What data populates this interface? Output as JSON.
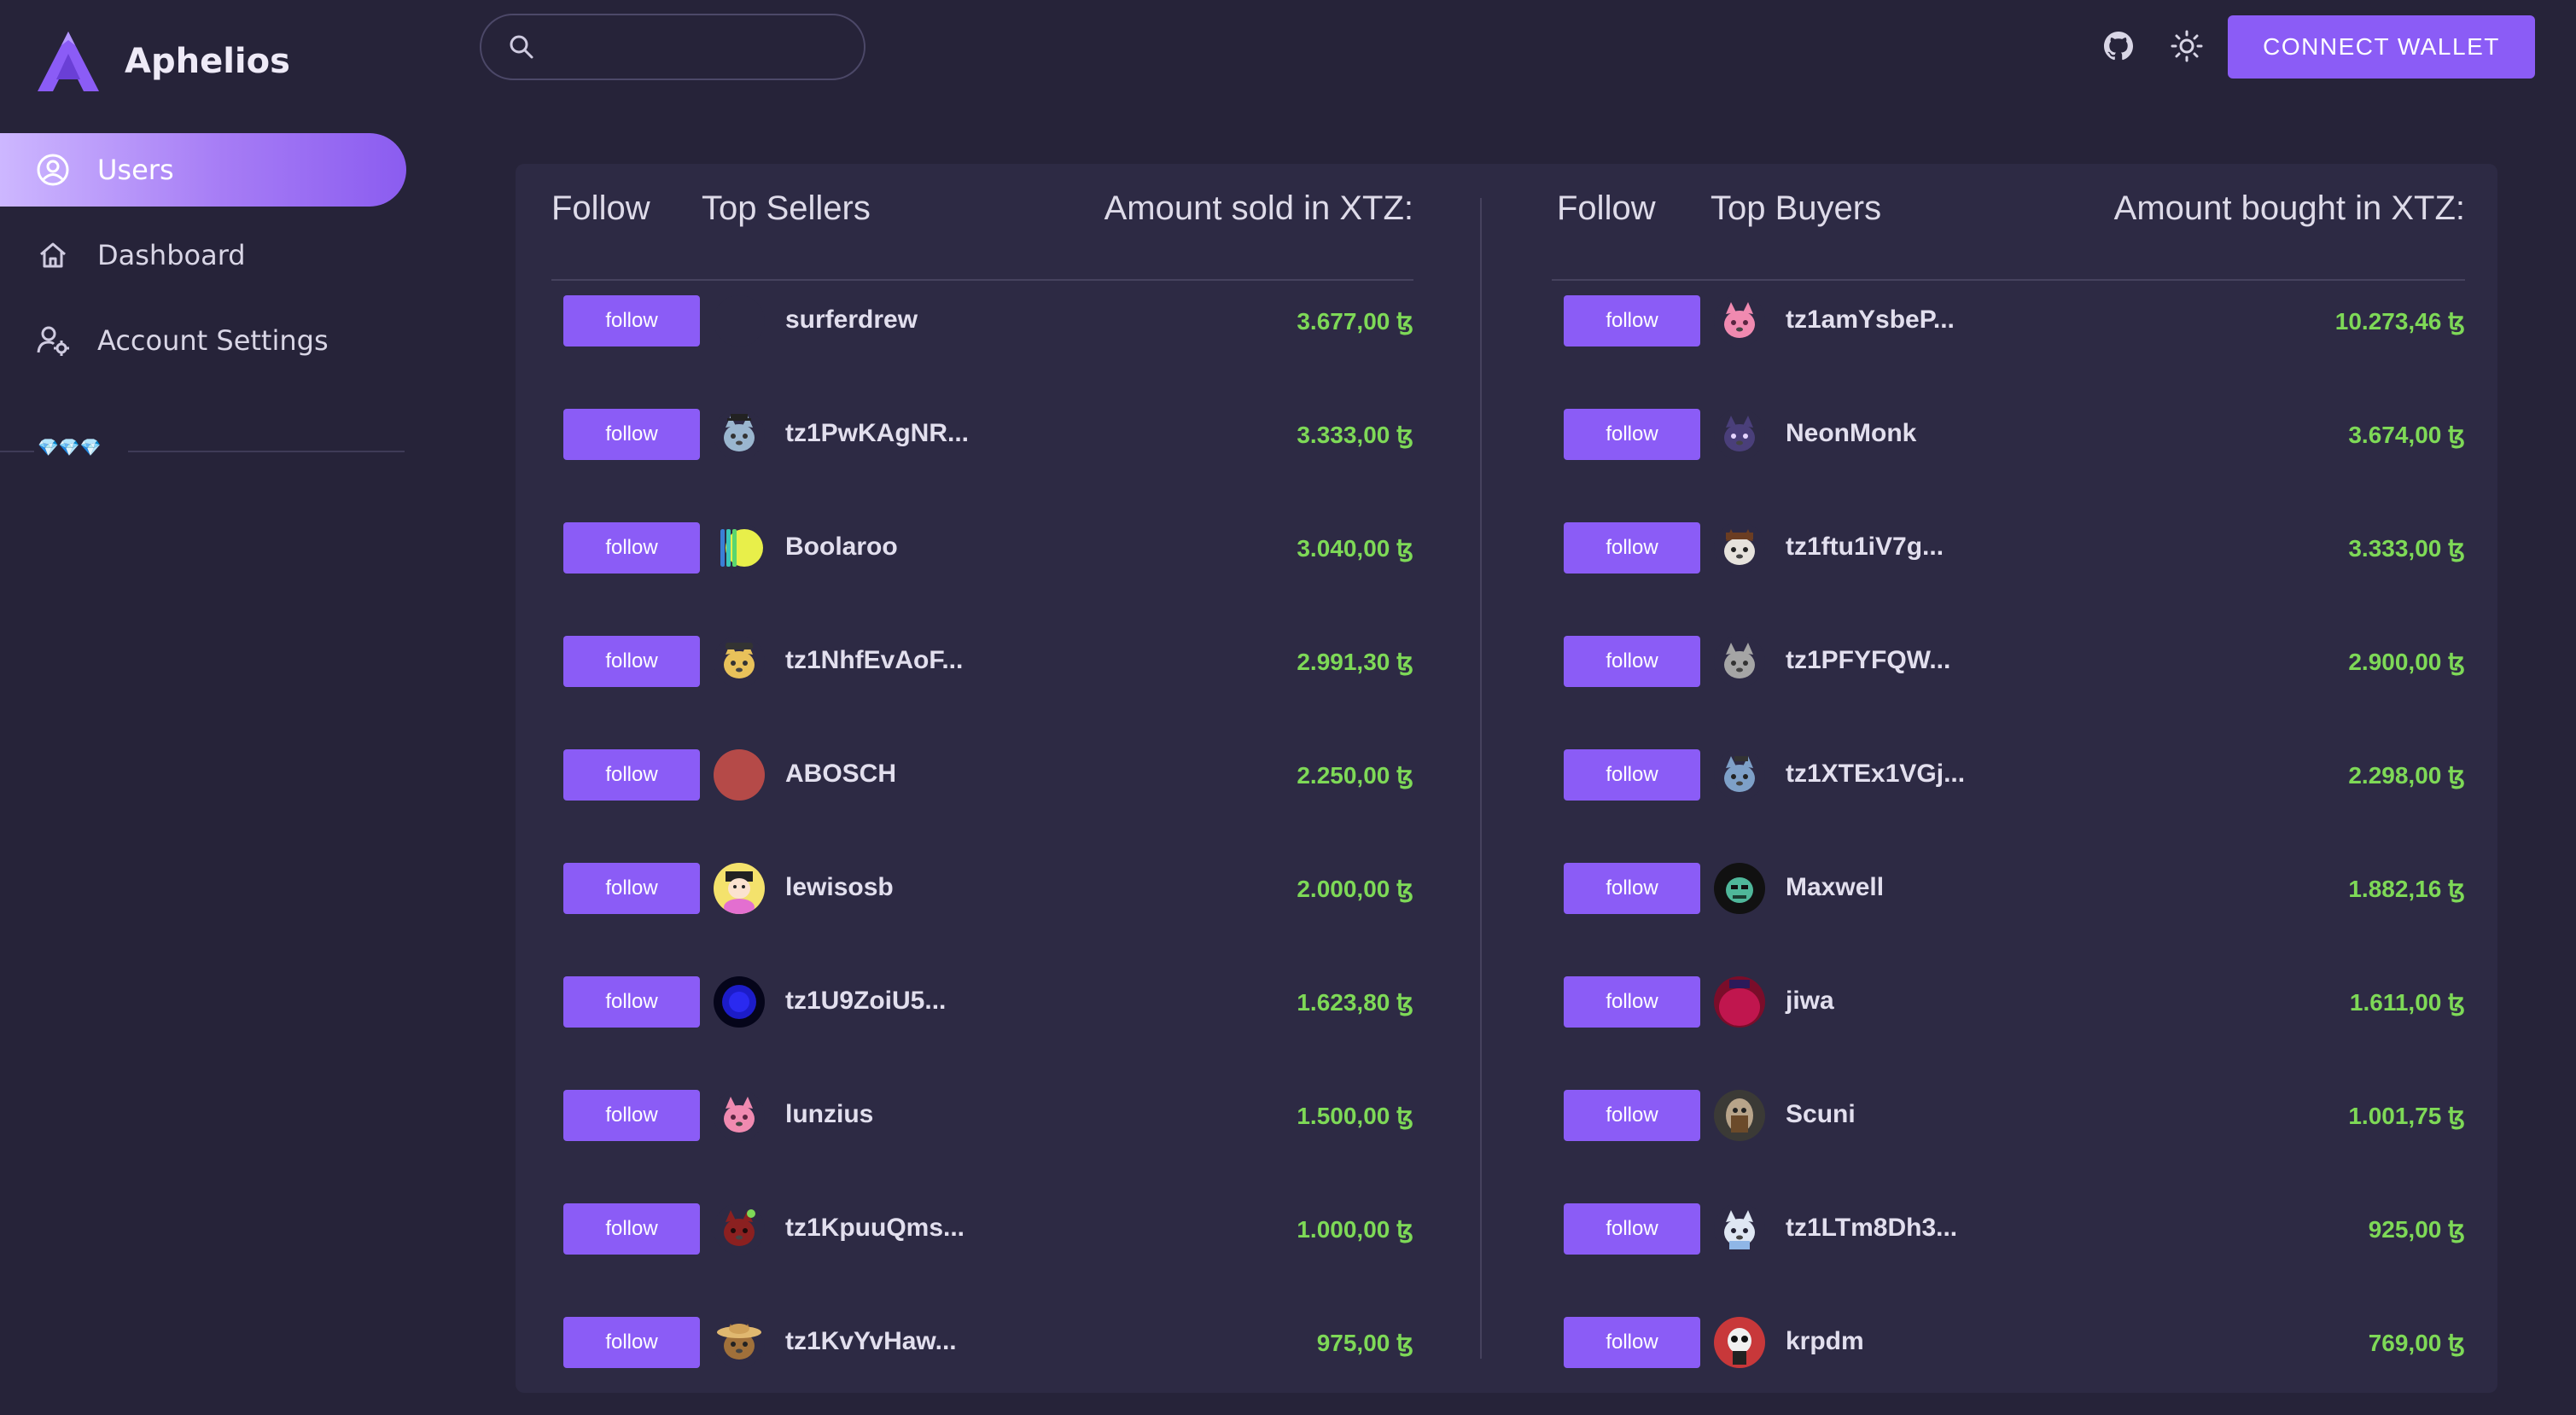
{
  "app": {
    "name": "Aphelios"
  },
  "sidebar": {
    "items": [
      {
        "label": "Users",
        "icon": "user-circle-icon",
        "active": true
      },
      {
        "label": "Dashboard",
        "icon": "home-icon",
        "active": false
      },
      {
        "label": "Account Settings",
        "icon": "user-gear-icon",
        "active": false
      }
    ],
    "gems": "💎💎💎"
  },
  "search": {
    "placeholder": "",
    "value": ""
  },
  "topbar": {
    "connect_label": "CONNECT WALLET",
    "github_icon": "github-icon",
    "theme_icon": "sun-icon"
  },
  "colors": {
    "accent": "#8b5cf6",
    "amount": "#7ed957",
    "background": "#262339",
    "card": "#2d2a44"
  },
  "sellers": {
    "col_follow": "Follow",
    "col_name": "Top Sellers",
    "col_amount": "Amount sold in XTZ:",
    "follow_label": "follow",
    "rows": [
      {
        "name": "surferdrew",
        "amount": "3.677,00 ꜩ",
        "avatar": "none"
      },
      {
        "name": "tz1PwKAgNR...",
        "amount": "3.333,00 ꜩ",
        "avatar": "cat-grad"
      },
      {
        "name": "Boolaroo",
        "amount": "3.040,00 ꜩ",
        "avatar": "stripes"
      },
      {
        "name": "tz1NhfEvAoF...",
        "amount": "2.991,30 ꜩ",
        "avatar": "cat-hat"
      },
      {
        "name": "ABOSCH",
        "amount": "2.250,00 ꜩ",
        "avatar": "red"
      },
      {
        "name": "lewisosb",
        "amount": "2.000,00 ꜩ",
        "avatar": "face"
      },
      {
        "name": "tz1U9ZoiU5...",
        "amount": "1.623,80 ꜩ",
        "avatar": "blue-orb"
      },
      {
        "name": "lunzius",
        "amount": "1.500,00 ꜩ",
        "avatar": "pink-cat"
      },
      {
        "name": "tz1KpuuQms...",
        "amount": "1.000,00 ꜩ",
        "avatar": "red-cat"
      },
      {
        "name": "tz1KvYvHaw...",
        "amount": "975,00 ꜩ",
        "avatar": "straw-hat"
      }
    ]
  },
  "buyers": {
    "col_follow": "Follow",
    "col_name": "Top Buyers",
    "col_amount": "Amount bought in XTZ:",
    "follow_label": "follow",
    "rows": [
      {
        "name": "tz1amYsbeP...",
        "amount": "10.273,46 ꜩ",
        "avatar": "pink-cat"
      },
      {
        "name": "NeonMonk",
        "amount": "3.674,00 ꜩ",
        "avatar": "purple-cat"
      },
      {
        "name": "tz1ftu1iV7g...",
        "amount": "3.333,00 ꜩ",
        "avatar": "brown-cat"
      },
      {
        "name": "tz1PFYFQW...",
        "amount": "2.900,00 ꜩ",
        "avatar": "grey-cat"
      },
      {
        "name": "tz1XTEx1VGj...",
        "amount": "2.298,00 ꜩ",
        "avatar": "blue-cat"
      },
      {
        "name": "Maxwell",
        "amount": "1.882,16 ꜩ",
        "avatar": "green-face"
      },
      {
        "name": "jiwa",
        "amount": "1.611,00 ꜩ",
        "avatar": "crimson"
      },
      {
        "name": "Scuni",
        "amount": "1.001,75 ꜩ",
        "avatar": "dark-art"
      },
      {
        "name": "tz1LTm8Dh3...",
        "amount": "925,00 ꜩ",
        "avatar": "white-cat"
      },
      {
        "name": "krpdm",
        "amount": "769,00 ꜩ",
        "avatar": "skull"
      }
    ]
  }
}
